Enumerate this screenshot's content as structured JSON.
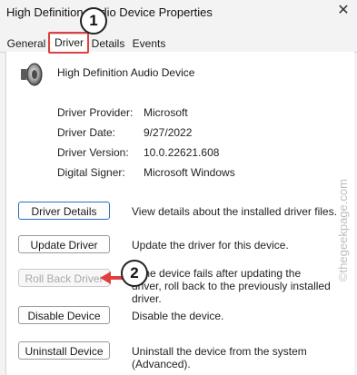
{
  "window": {
    "title": "High Definition Audio Device Properties",
    "close_glyph": "✕"
  },
  "tabs": [
    {
      "label": "General",
      "active": false
    },
    {
      "label": "Driver",
      "active": true
    },
    {
      "label": "Details",
      "active": false
    },
    {
      "label": "Events",
      "active": false
    }
  ],
  "device": {
    "name": "High Definition Audio Device",
    "icon": "speaker-icon"
  },
  "info": [
    {
      "label": "Driver Provider:",
      "value": "Microsoft"
    },
    {
      "label": "Driver Date:",
      "value": "9/27/2022"
    },
    {
      "label": "Driver Version:",
      "value": "10.0.22621.608"
    },
    {
      "label": "Digital Signer:",
      "value": "Microsoft Windows"
    }
  ],
  "actions": [
    {
      "label": "Driver Details",
      "desc": "View details about the installed driver files.",
      "enabled": true
    },
    {
      "label": "Update Driver",
      "desc": "Update the driver for this device.",
      "enabled": true
    },
    {
      "label": "Roll Back Driver",
      "desc": "If the device fails after updating the driver, roll back to the previously installed driver.",
      "enabled": false
    },
    {
      "label": "Disable Device",
      "desc": "Disable the device.",
      "enabled": true
    },
    {
      "label": "Uninstall Device",
      "desc": "Uninstall the device from the system (Advanced).",
      "enabled": true
    }
  ],
  "annotations": {
    "step1": "1",
    "step2": "2",
    "highlight_color": "#e0403d"
  },
  "watermark": "©thegeekpage.com"
}
